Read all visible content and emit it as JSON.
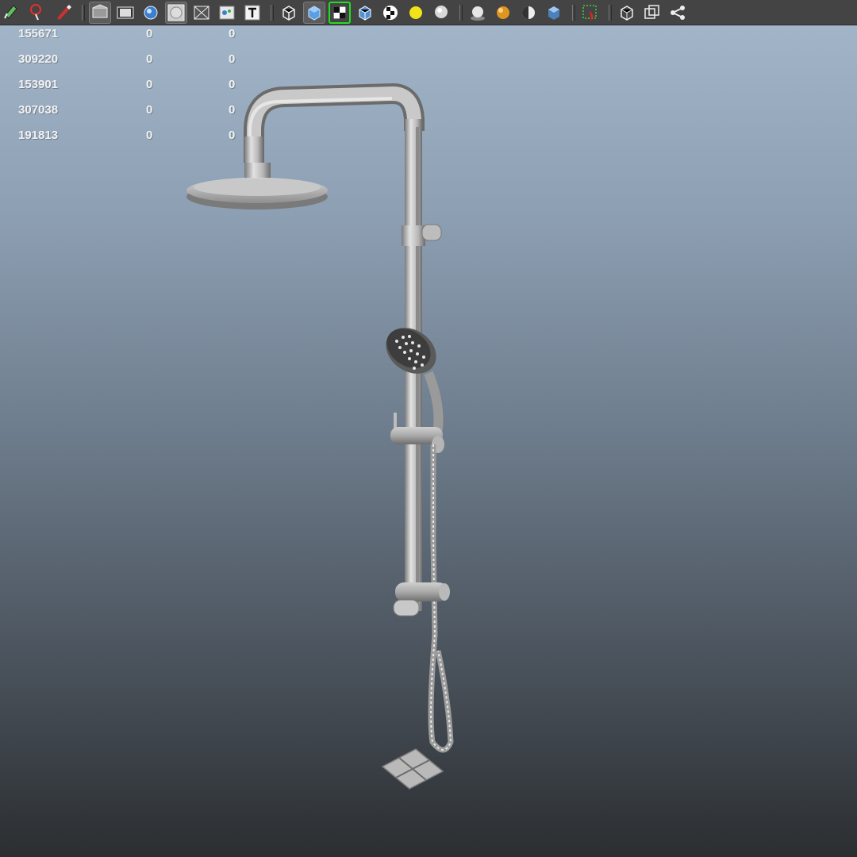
{
  "toolbar": {
    "groups": [
      [
        "select-tool-icon",
        "lasso-tool-icon",
        "paint-tool-icon"
      ],
      [
        "camera-attributes-icon",
        "film-gate-icon",
        "image-plane-icon",
        "resolution-gate-icon",
        "safe-action-icon",
        "field-chart-icon",
        "text-overlay-icon"
      ],
      [
        "wireframe-icon",
        "smooth-shade-icon",
        "textured-icon",
        "wireframe-on-shaded-icon",
        "checker-icon",
        "use-default-lights-icon",
        "shadows-icon"
      ],
      [
        "ambient-occlusion-icon",
        "motion-blur-icon",
        "anti-aliasing-icon",
        "depth-of-field-icon"
      ],
      [
        "isolate-select-icon"
      ],
      [
        "xray-icon",
        "xray-joints-icon",
        "share-icon"
      ]
    ]
  },
  "hud": {
    "rows": [
      {
        "c1": "155671",
        "c2": "0",
        "c3": "0"
      },
      {
        "c1": "309220",
        "c2": "0",
        "c3": "0"
      },
      {
        "c1": "153901",
        "c2": "0",
        "c3": "0"
      },
      {
        "c1": "307038",
        "c2": "0",
        "c3": "0"
      },
      {
        "c1": "191813",
        "c2": "0",
        "c3": "0"
      }
    ]
  },
  "colors": {
    "bg_top": "#a4b7cb",
    "bg_bottom": "#2b2e31",
    "toolbar_bg": "#444444",
    "hud_text": "#f2f2f2",
    "model_light": "#d8d8d8",
    "model_mid": "#aaaaaa",
    "model_dark": "#6a6a6a"
  }
}
